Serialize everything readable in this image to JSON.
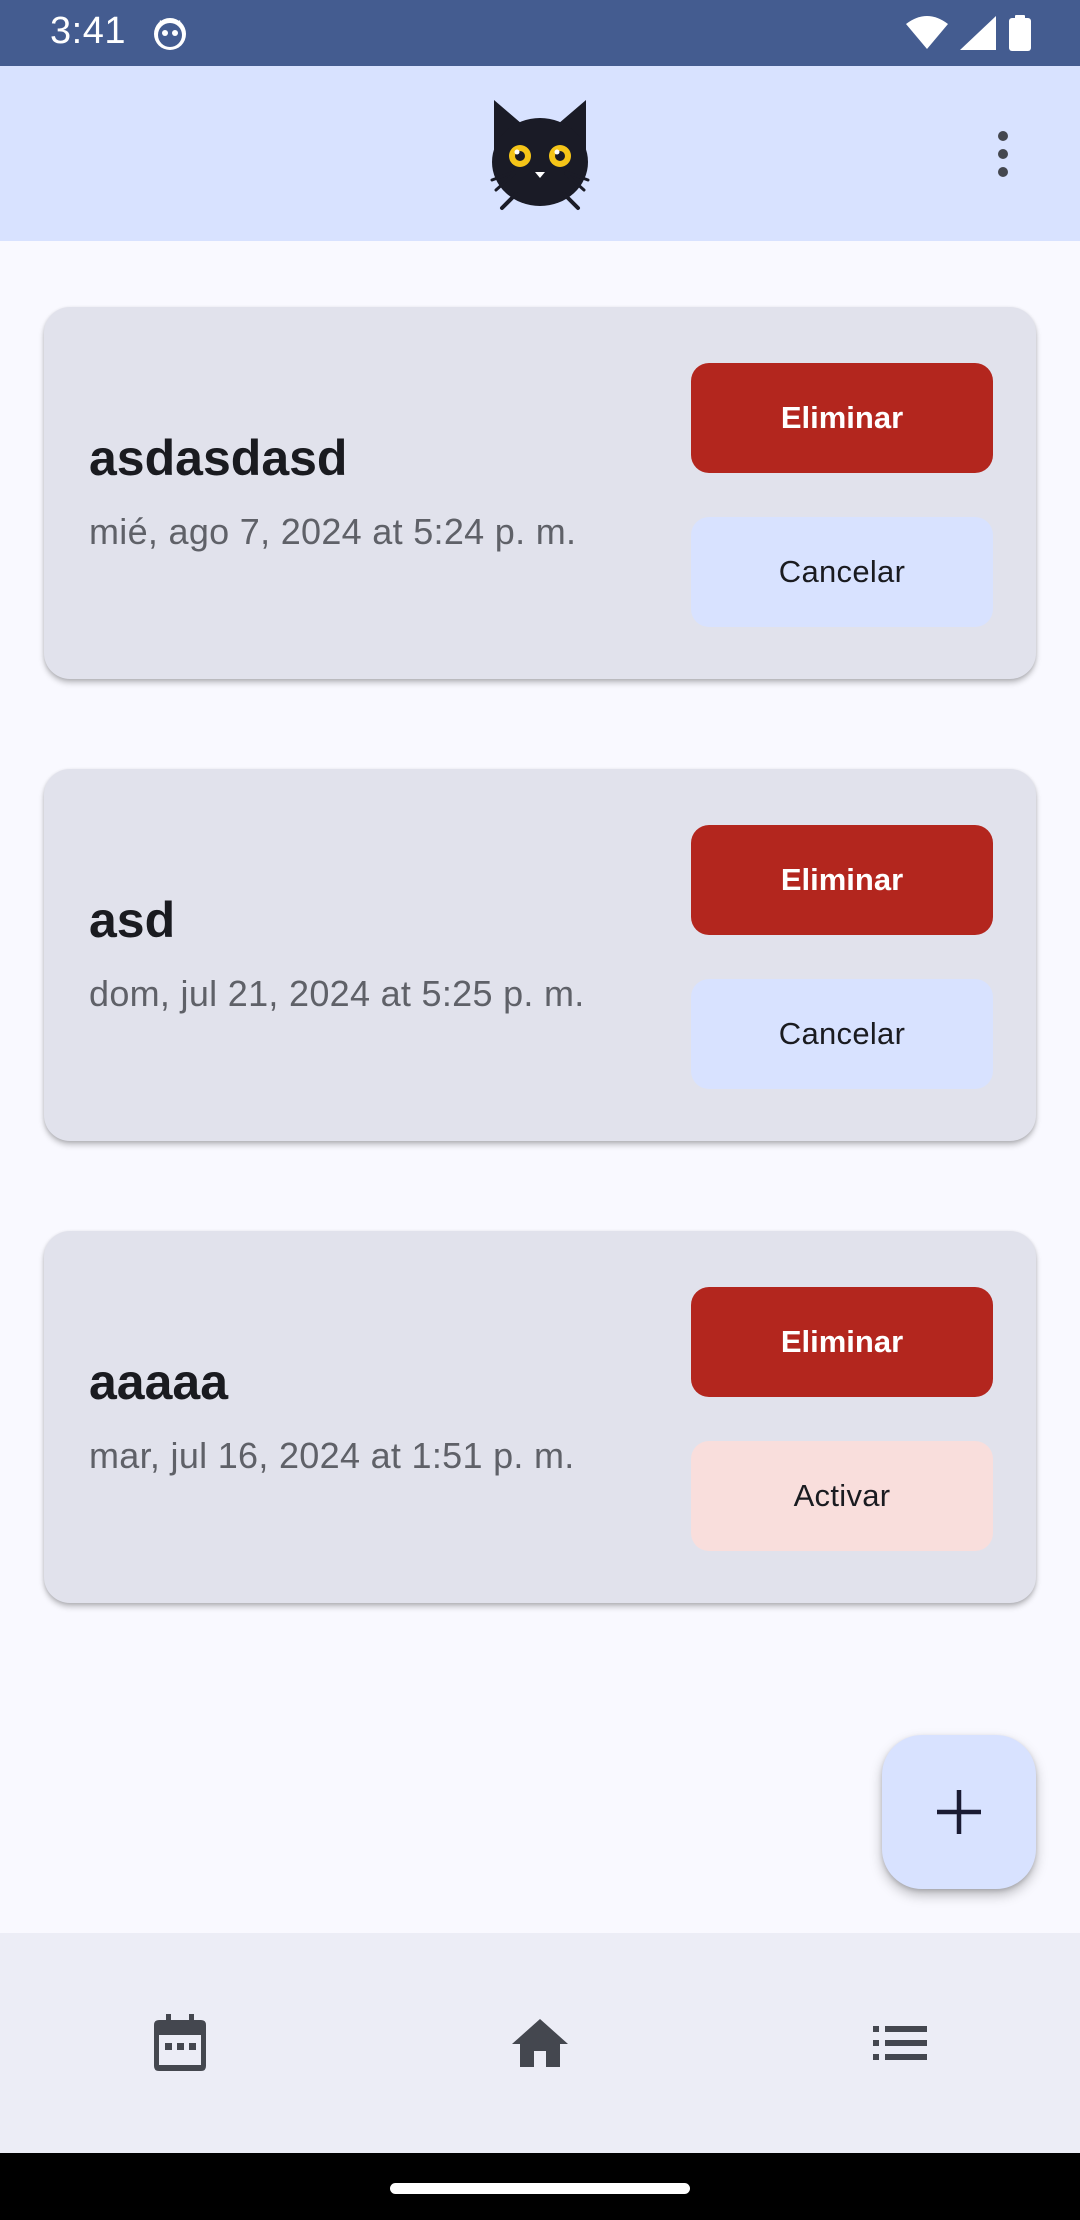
{
  "status_bar": {
    "time": "3:41",
    "icons": [
      "cat-notification-icon",
      "wifi-icon",
      "signal-icon",
      "battery-icon"
    ]
  },
  "app_bar": {
    "logo_icon": "black-cat-logo",
    "menu_icon": "more-vert-icon"
  },
  "alarms": [
    {
      "title": "asdasdasd",
      "date": "mié, ago 7, 2024 at 5:24 p. m.",
      "delete_label": "Eliminar",
      "toggle_label": "Cancelar"
    },
    {
      "title": "asd",
      "date": "dom, jul 21, 2024 at 5:25 p. m.",
      "delete_label": "Eliminar",
      "toggle_label": "Cancelar"
    },
    {
      "title": "aaaaa",
      "date": "mar, jul 16, 2024 at 1:51 p. m.",
      "delete_label": "Eliminar",
      "toggle_label": "Activar"
    }
  ],
  "fab": {
    "icon": "add-icon"
  },
  "bottom_nav": {
    "items": [
      {
        "icon": "calendar-icon"
      },
      {
        "icon": "home-icon"
      },
      {
        "icon": "list-icon"
      }
    ]
  },
  "colors": {
    "status_bar": "#445c90",
    "app_bar": "#d8e2ff",
    "card": "#e1e2ec",
    "delete_button": "#b3261e",
    "cancel_button": "#d8e2ff",
    "activate_button": "#f9dedc",
    "background": "#f9f9ff",
    "bottom_nav": "#ecedf6"
  }
}
